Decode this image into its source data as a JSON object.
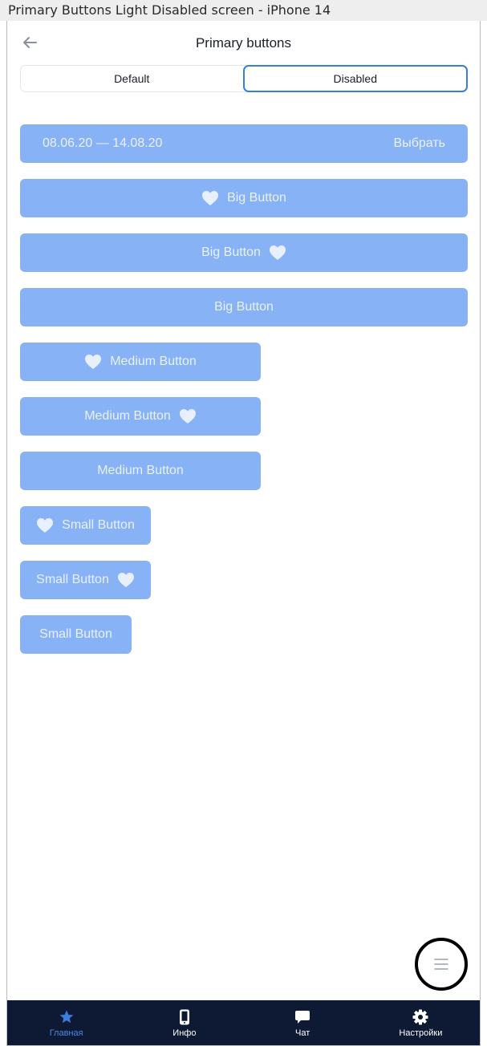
{
  "caption": "Primary Buttons Light Disabled screen - iPhone 14",
  "header": {
    "title": "Primary buttons"
  },
  "segmented": {
    "options": [
      "Default",
      "Disabled"
    ],
    "selected": "Disabled"
  },
  "date_button": {
    "range": "08.06.20 — 14.08.20",
    "action": "Выбрать"
  },
  "buttons": {
    "big": "Big Button",
    "medium": "Medium Button",
    "small": "Small Button"
  },
  "tabbar": {
    "items": [
      {
        "label": "Главная",
        "icon": "star-icon",
        "active": true
      },
      {
        "label": "Инфо",
        "icon": "phone-icon",
        "active": false
      },
      {
        "label": "Чат",
        "icon": "chat-bubble-icon",
        "active": false
      },
      {
        "label": "Настройки",
        "icon": "gear-icon",
        "active": false
      }
    ]
  },
  "colors": {
    "button_disabled": "#88b2f6",
    "accent": "#3b7ddd",
    "tab_active": "#4c86e8",
    "tabbar_bg": "#0e1a33"
  }
}
